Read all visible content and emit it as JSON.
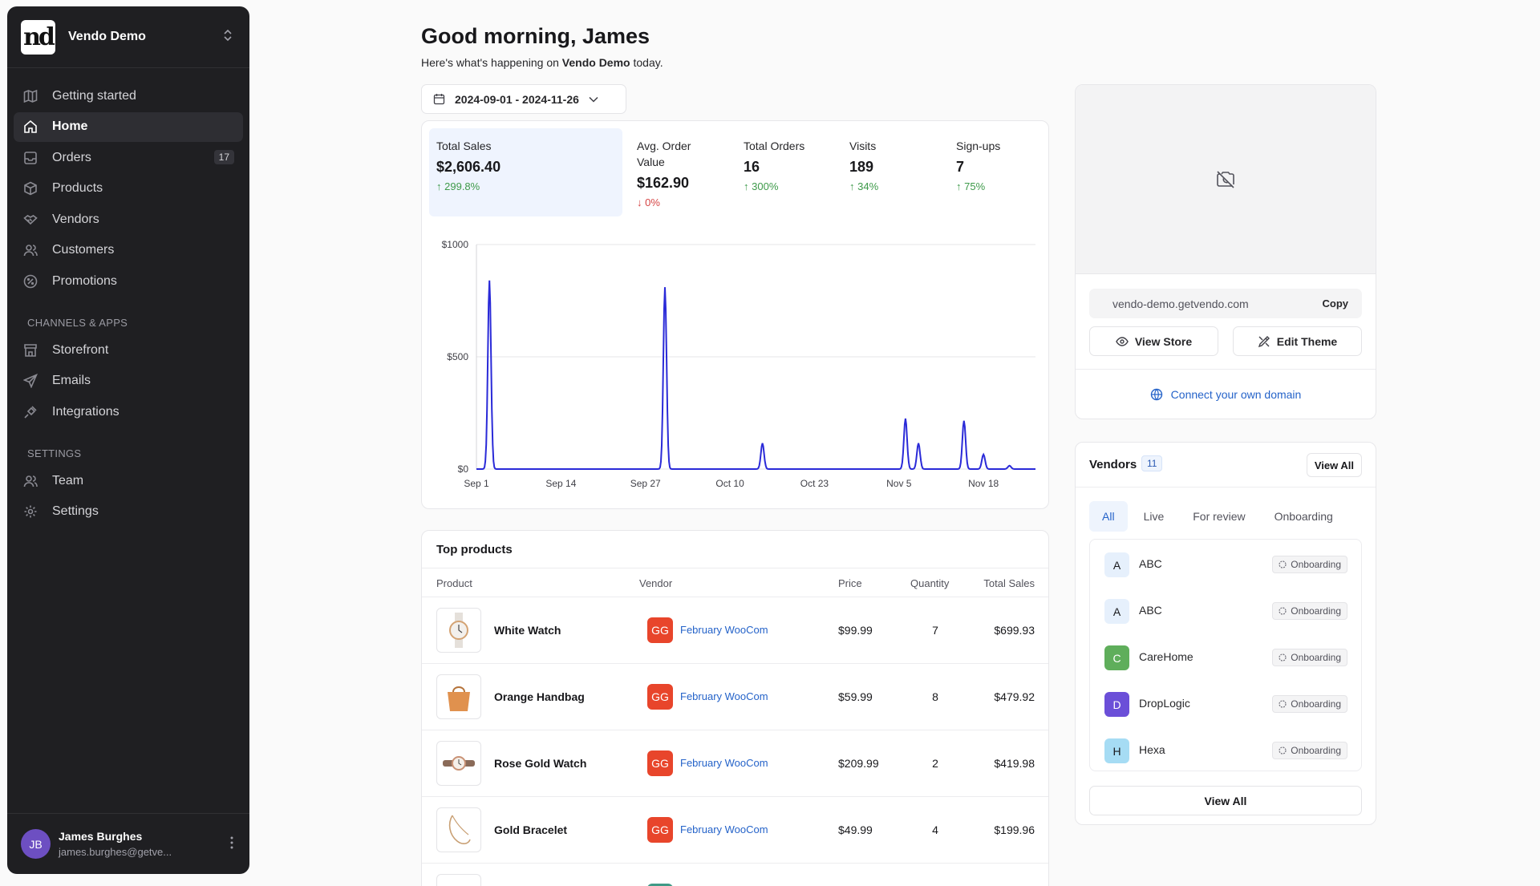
{
  "workspace": {
    "name": "Vendo Demo",
    "logo_text": "nd"
  },
  "nav": [
    {
      "label": "Getting started"
    },
    {
      "label": "Home"
    },
    {
      "label": "Orders",
      "badge": "17"
    },
    {
      "label": "Products"
    },
    {
      "label": "Vendors"
    },
    {
      "label": "Customers"
    },
    {
      "label": "Promotions"
    }
  ],
  "channels": {
    "title": "CHANNELS & APPS",
    "items": [
      {
        "label": "Storefront"
      },
      {
        "label": "Emails"
      },
      {
        "label": "Integrations"
      }
    ]
  },
  "settings": {
    "title": "SETTINGS",
    "items": [
      {
        "label": "Team"
      },
      {
        "label": "Settings"
      }
    ]
  },
  "user": {
    "initials": "JB",
    "name": "James Burghes",
    "email": "james.burghes@getve..."
  },
  "header": {
    "greeting": "Good morning, James",
    "sub_prefix": "Here's what's happening on",
    "sub_store": "Vendo Demo",
    "sub_suffix": "today.",
    "date_range": "2024-09-01 - 2024-11-26"
  },
  "kpis": [
    {
      "label": "Total Sales",
      "value": "$2,606.40",
      "delta": "299.8%",
      "dir": "up"
    },
    {
      "label": "Avg. Order Value",
      "value": "$162.90",
      "delta": "0%",
      "dir": "down"
    },
    {
      "label": "Total Orders",
      "value": "16",
      "delta": "300%",
      "dir": "up"
    },
    {
      "label": "Visits",
      "value": "189",
      "delta": "34%",
      "dir": "up"
    },
    {
      "label": "Sign-ups",
      "value": "7",
      "delta": "75%",
      "dir": "up"
    }
  ],
  "chart_data": {
    "type": "line",
    "x_tick_labels": [
      "Sep 1",
      "Sep 14",
      "Sep 27",
      "Oct 10",
      "Oct 23",
      "Nov 5",
      "Nov 18"
    ],
    "y_tick_labels": [
      "$0",
      "$500",
      "$1000"
    ],
    "ylim": [
      0,
      1000
    ],
    "x_range_days": [
      0,
      86
    ],
    "series_color": "#2a2ad8",
    "peaks": [
      {
        "day": 2,
        "value": 840
      },
      {
        "day": 29,
        "value": 810
      },
      {
        "day": 44,
        "value": 115
      },
      {
        "day": 66,
        "value": 225
      },
      {
        "day": 68,
        "value": 115
      },
      {
        "day": 75,
        "value": 215
      },
      {
        "day": 78,
        "value": 65
      },
      {
        "day": 82,
        "value": 15
      }
    ],
    "grid": true
  },
  "top_products": {
    "title": "Top products",
    "columns": [
      "Product",
      "Vendor",
      "Price",
      "Quantity",
      "Total Sales"
    ],
    "rows": [
      {
        "name": "White Watch",
        "vendor_initials": "GG",
        "vendor": "February WooCom",
        "price": "$99.99",
        "qty": "7",
        "total": "$699.93",
        "img": "watch-white"
      },
      {
        "name": "Orange Handbag",
        "vendor_initials": "GG",
        "vendor": "February WooCom",
        "price": "$59.99",
        "qty": "8",
        "total": "$479.92",
        "img": "handbag"
      },
      {
        "name": "Rose Gold Watch",
        "vendor_initials": "GG",
        "vendor": "February WooCom",
        "price": "$209.99",
        "qty": "2",
        "total": "$419.98",
        "img": "watch-rose"
      },
      {
        "name": "Gold Bracelet",
        "vendor_initials": "GG",
        "vendor": "February WooCom",
        "price": "$49.99",
        "qty": "4",
        "total": "$199.96",
        "img": "bracelet"
      }
    ]
  },
  "store": {
    "url": "vendo-demo.getvendo.com",
    "copy_label": "Copy",
    "view_store": "View Store",
    "edit_theme": "Edit Theme",
    "connect_domain": "Connect your own domain"
  },
  "vendors": {
    "title": "Vendors",
    "count": "11",
    "view_all_small": "View All",
    "tabs": [
      "All",
      "Live",
      "For review",
      "Onboarding"
    ],
    "items": [
      {
        "initial": "A",
        "name": "ABC",
        "status": "Onboarding",
        "color": "#e6f0fc"
      },
      {
        "initial": "A",
        "name": "ABC",
        "status": "Onboarding",
        "color": "#e6f0fc"
      },
      {
        "initial": "C",
        "name": "CareHome",
        "status": "Onboarding",
        "color": "#5fae5b"
      },
      {
        "initial": "D",
        "name": "DropLogic",
        "status": "Onboarding",
        "color": "#6b4fd8"
      },
      {
        "initial": "H",
        "name": "Hexa",
        "status": "Onboarding",
        "color": "#a6dcf4"
      }
    ],
    "view_all": "View All"
  }
}
